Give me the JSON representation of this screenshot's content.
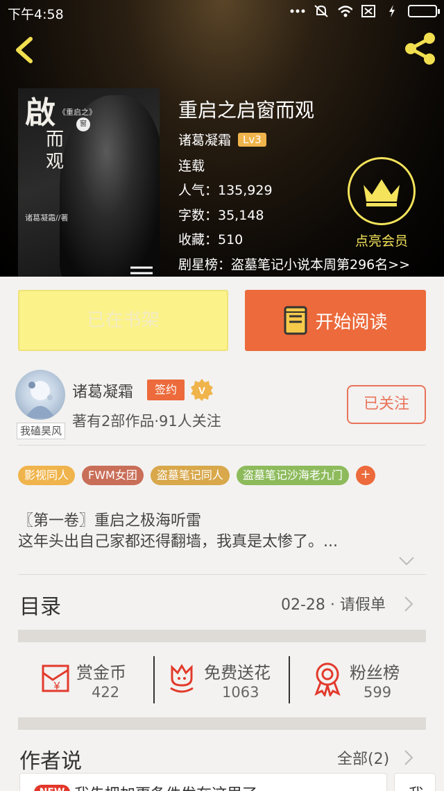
{
  "status_bar": {
    "time": "下午4:58",
    "icons": [
      "more-dots-icon",
      "mute-icon",
      "wifi-icon",
      "sim-off-icon",
      "charging-icon",
      "battery-icon"
    ]
  },
  "header": {
    "back_icon": "chevron-left-icon",
    "share_icon": "share-icon"
  },
  "cover": {
    "title_line1": "啟",
    "title_line2": "而",
    "title_line3": "观",
    "subtitle": "《重启之》",
    "badge": "窗",
    "author_line": "诸葛凝霜//著"
  },
  "book": {
    "title": "重启之启窗而观",
    "author": "诸葛凝霜",
    "level": "Lv3",
    "status": "连载",
    "popularity": "人气：135,929",
    "word_count": "字数：35,148",
    "favorites": "收藏：510",
    "ranking": "剧星榜：盗墓笔记小说本周第296名>>"
  },
  "vip": {
    "label": "点亮会员",
    "icon": "crown-icon"
  },
  "actions": {
    "shelf_label": "已在书架",
    "read_label": "开始阅读",
    "read_icon": "book-icon"
  },
  "author": {
    "name": "诸葛凝霜",
    "avatar_caption": "我磕昊风",
    "sign_badge": "签约",
    "verified_badge": "V",
    "meta": "著有2部作品·91人关注",
    "follow_label": "已关注"
  },
  "tags": [
    {
      "label": "影视同人",
      "color": "#f0b44c"
    },
    {
      "label": "FWM女团",
      "color": "#c96e58"
    },
    {
      "label": "盗墓笔记同人",
      "color": "#d8a84b"
    },
    {
      "label": "盗墓笔记沙海老九门",
      "color": "#8dbb5c"
    }
  ],
  "tags_more": "+",
  "intro": {
    "line1": "〖第一卷〗重启之极海听雷",
    "line2": "这年头出自己家都还得翻墙，我真是太惨了。..."
  },
  "toc": {
    "title": "目录",
    "latest": "02-28 · 请假单"
  },
  "stats": [
    {
      "label": "赏金币",
      "value": "422",
      "icon": "reward-coin-icon"
    },
    {
      "label": "免费送花",
      "value": "1063",
      "icon": "flower-icon"
    },
    {
      "label": "粉丝榜",
      "value": "599",
      "icon": "medal-icon"
    }
  ],
  "author_says": {
    "title": "作者说",
    "all_label": "全部(2)",
    "new_badge": "NEW",
    "item1": "我先把加更条件发在这里了",
    "item2": "我"
  }
}
